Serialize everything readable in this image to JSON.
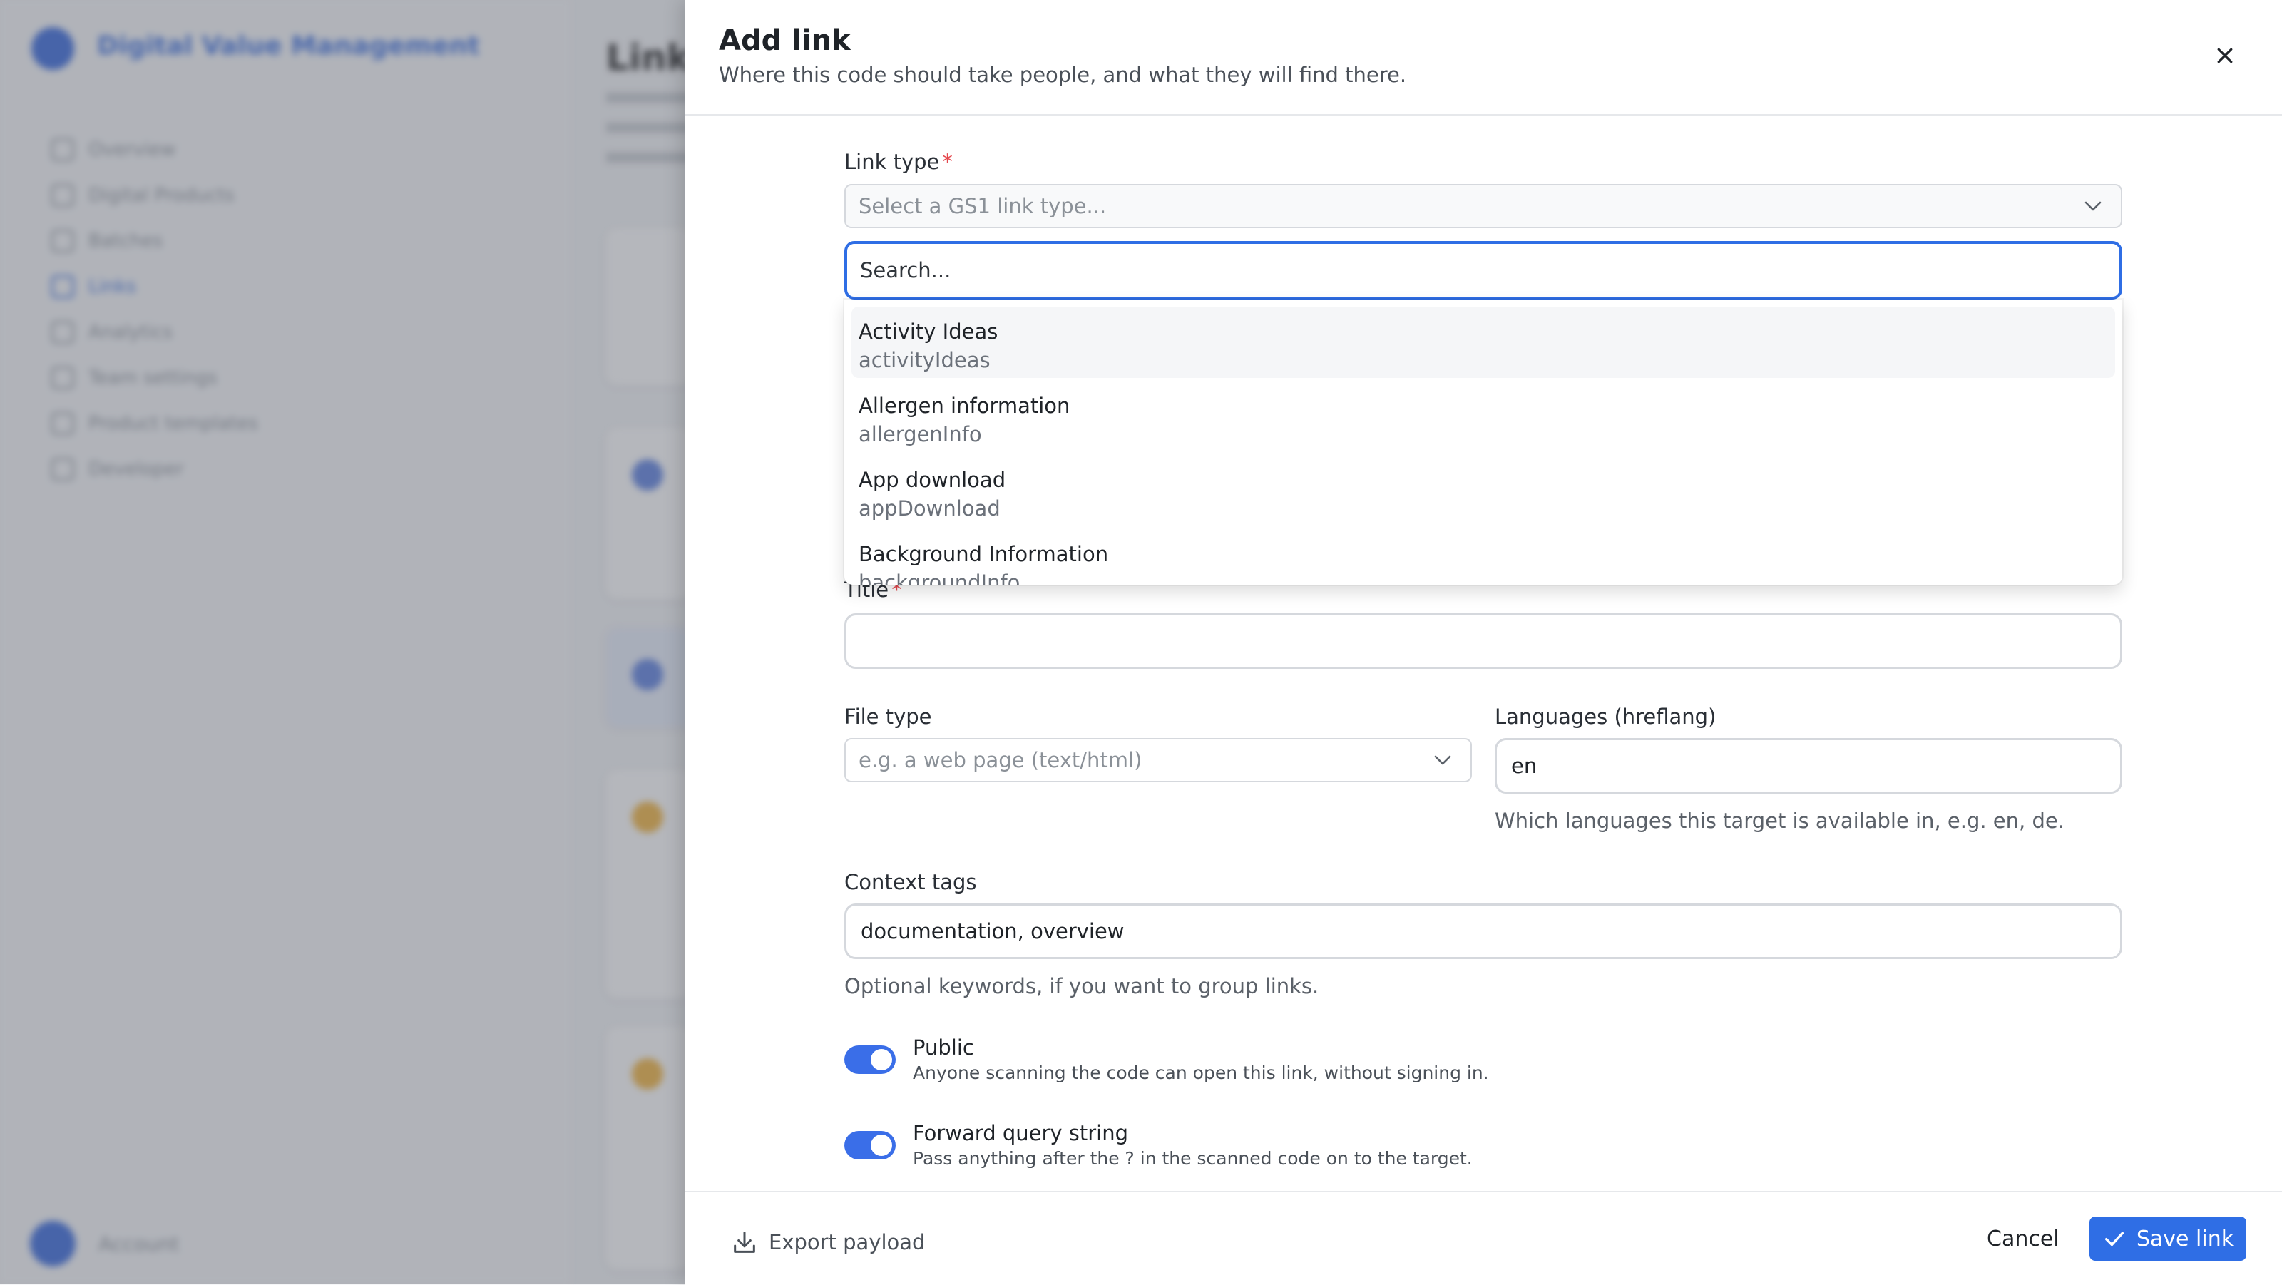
{
  "background": {
    "brand": "Digital Value Management",
    "nav_items": [
      "Overview",
      "Digital Products",
      "Batches",
      "Links",
      "Analytics",
      "Team settings",
      "Product templates",
      "Developer"
    ],
    "active_nav_index": 3,
    "user": "Account",
    "main_title": "Links"
  },
  "panel": {
    "title": "Add link",
    "subtitle": "Where this code should take people, and what they will find there."
  },
  "link_type": {
    "label": "Link type",
    "required_mark": "*",
    "placeholder": "Select a GS1 link type..."
  },
  "search": {
    "placeholder": "Search..."
  },
  "options": [
    {
      "label": "Activity Ideas",
      "code": "activityIdeas"
    },
    {
      "label": "Allergen information",
      "code": "allergenInfo"
    },
    {
      "label": "App download",
      "code": "appDownload"
    },
    {
      "label": "Background Information",
      "code": "backgroundInfo"
    }
  ],
  "title_field": {
    "label": "Title",
    "required_mark": "*",
    "value": ""
  },
  "file_type": {
    "label": "File type",
    "placeholder": "e.g. a web page (text/html)"
  },
  "languages": {
    "label": "Languages (hreflang)",
    "value": "en",
    "helper": "Which languages this target is available in, e.g. en, de."
  },
  "context_tags": {
    "label": "Context tags",
    "value": "documentation, overview",
    "helper": "Optional keywords, if you want to group links."
  },
  "toggles": {
    "public": {
      "title": "Public",
      "desc": "Anyone scanning the code can open this link, without signing in.",
      "on": true
    },
    "forward": {
      "title": "Forward query string",
      "desc": "Pass anything after the ? in the scanned code on to the target.",
      "on": true
    }
  },
  "footer": {
    "export_label": "Export payload",
    "cancel_label": "Cancel",
    "save_label": "Save link"
  },
  "colors": {
    "accent": "#2f6ee5",
    "required": "#e5484d",
    "border": "#d5d8dd"
  }
}
